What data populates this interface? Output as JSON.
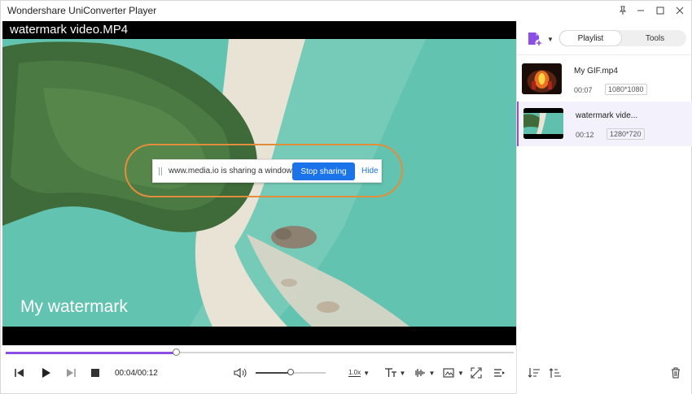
{
  "window": {
    "title": "Wondershare UniConverter Player"
  },
  "video": {
    "title": "watermark video.MP4",
    "watermark_text": "My watermark"
  },
  "share_banner": {
    "message": "www.media.io is sharing a window.",
    "stop_label": "Stop sharing",
    "hide_label": "Hide"
  },
  "playback": {
    "time_display": "00:04/00:12",
    "progress_fraction": 0.335,
    "volume_fraction": 0.5,
    "speed_label": "1.0x"
  },
  "panel": {
    "tabs": [
      {
        "label": "Playlist",
        "active": true
      },
      {
        "label": "Tools",
        "active": false
      }
    ],
    "items": [
      {
        "name": "My GIF.mp4",
        "duration": "00:07",
        "resolution": "1080*1080",
        "selected": false
      },
      {
        "name": "watermark vide...",
        "duration": "00:12",
        "resolution": "1280*720",
        "selected": true
      }
    ]
  },
  "colors": {
    "accent": "#8b4fe6",
    "share_button": "#1a73e8",
    "highlight_ring": "#e28d3b",
    "water": "#5fc2ae"
  },
  "icons": {
    "pin": "pin-icon",
    "minimize": "minimize-icon",
    "maximize": "maximize-icon",
    "close": "close-icon",
    "add_file": "add-file-icon",
    "prev": "previous-frame-icon",
    "play": "play-icon",
    "next": "next-frame-icon",
    "stop": "stop-icon",
    "volume": "volume-icon",
    "speed": "speed-icon",
    "subtitle": "subtitle-icon",
    "audio": "audio-track-icon",
    "snapshot": "snapshot-icon",
    "playlist_toggle": "playlist-toggle-icon",
    "sort_desc": "sort-descending-icon",
    "sort_asc": "sort-ascending-icon",
    "delete": "delete-icon"
  }
}
